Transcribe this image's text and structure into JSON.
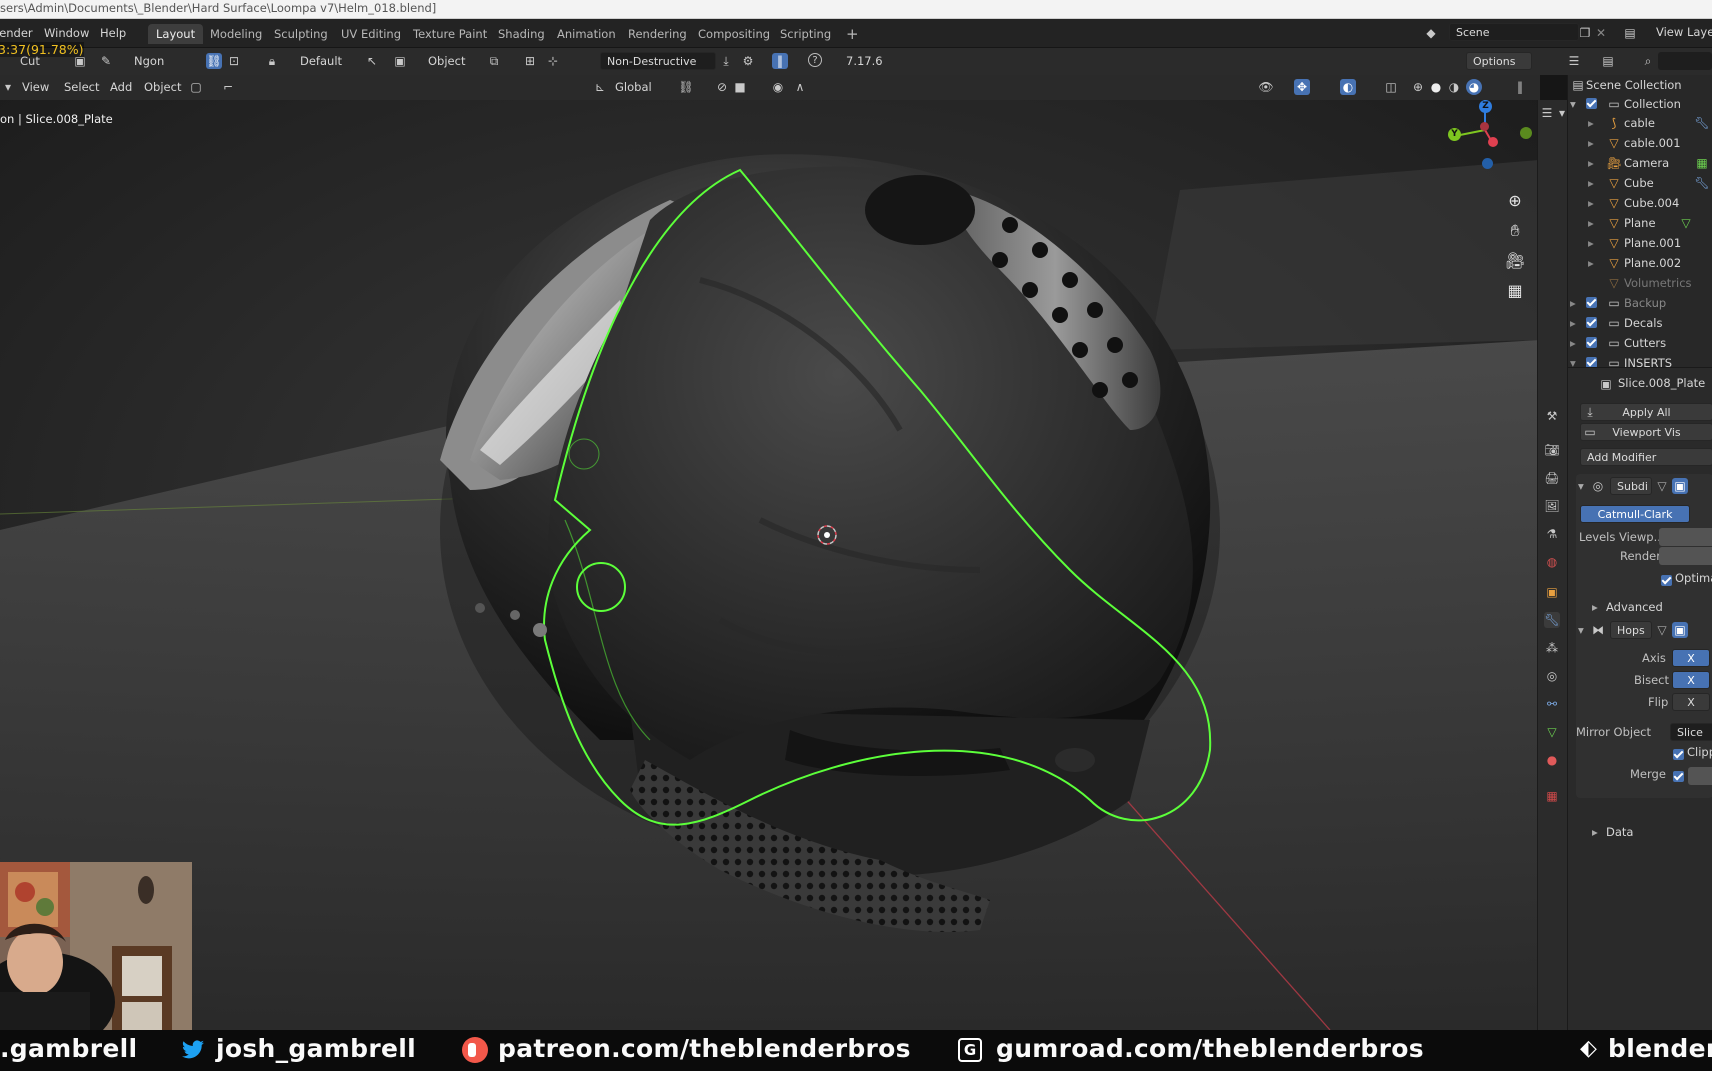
{
  "window": {
    "title_path": "sers\\Admin\\Documents\\_Blender\\Hard Surface\\Loompa v7\\Helm_018.blend]"
  },
  "menus": [
    "lender",
    "Window",
    "Help"
  ],
  "workspaces": [
    "Layout",
    "Modeling",
    "Sculpting",
    "UV Editing",
    "Texture Paint",
    "Shading",
    "Animation",
    "Rendering",
    "Compositing",
    "Scripting"
  ],
  "workspace_add": "+",
  "scene": {
    "name": "Scene",
    "view_layer": "View Layer"
  },
  "toolbar": {
    "timer": "3:37(91.78%)",
    "tool": "Cut",
    "mode_value": "Ngon",
    "snap_value": "Default",
    "object_label": "Object",
    "boolean_mode": "Non-Destructive",
    "version": "7.17.6",
    "options_label": "Options"
  },
  "viewport_header": {
    "view": "View",
    "select": "Select",
    "add": "Add",
    "object": "Object",
    "orientation": "Global"
  },
  "viewport": {
    "object_info": "on | Slice.008_Plate",
    "gizmo_axes": [
      "Z",
      "Y"
    ]
  },
  "outliner": {
    "root": "Scene Collection",
    "items": [
      {
        "label": "Collection",
        "kind": "collection"
      },
      {
        "label": "cable",
        "kind": "curve"
      },
      {
        "label": "cable.001",
        "kind": "mesh"
      },
      {
        "label": "Camera",
        "kind": "camera"
      },
      {
        "label": "Cube",
        "kind": "mesh"
      },
      {
        "label": "Cube.004",
        "kind": "mesh"
      },
      {
        "label": "Plane",
        "kind": "mesh"
      },
      {
        "label": "Plane.001",
        "kind": "mesh"
      },
      {
        "label": "Plane.002",
        "kind": "mesh"
      },
      {
        "label": "Volumetrics",
        "kind": "mesh"
      },
      {
        "label": "Backup",
        "kind": "collection"
      },
      {
        "label": "Decals",
        "kind": "collection"
      },
      {
        "label": "Cutters",
        "kind": "collection"
      },
      {
        "label": "INSERTS",
        "kind": "collection"
      }
    ]
  },
  "properties": {
    "object_name": "Slice.008_Plate",
    "apply_all": "Apply All",
    "viewport_vis": "Viewport Vis",
    "add_modifier": "Add Modifier",
    "mod1": {
      "name": "Subdi",
      "type_value": "Catmull-Clark",
      "levels_label": "Levels Viewp...",
      "render_label": "Render",
      "optimal_label": "Optima",
      "advanced": "Advanced"
    },
    "mod2": {
      "name": "Hops",
      "axis_label": "Axis",
      "axis_value": "X",
      "bisect_label": "Bisect",
      "bisect_value": "X",
      "flip_label": "Flip",
      "flip_value": "X",
      "mirror_object_label": "Mirror Object",
      "mirror_object_value": "Slice",
      "clipping_label": "Clippin",
      "merge_label": "Merge",
      "data": "Data"
    }
  },
  "footer": {
    "items": [
      {
        "text": ".gambrell",
        "icon": "none"
      },
      {
        "text": "josh_gambrell",
        "icon": "twitter-icon"
      },
      {
        "text": "patreon.com/theblenderbros",
        "icon": "patreon-icon"
      },
      {
        "text": "gumroad.com/theblenderbros",
        "icon": "gumroad-icon"
      },
      {
        "text": "blenderbr",
        "icon": "blender-icon"
      }
    ]
  },
  "colors": {
    "accent": "#4772b3",
    "selection": "#5cff3a",
    "xaxis": "#e04050",
    "yaxis": "#7ec620",
    "zaxis": "#2f7ddf"
  }
}
